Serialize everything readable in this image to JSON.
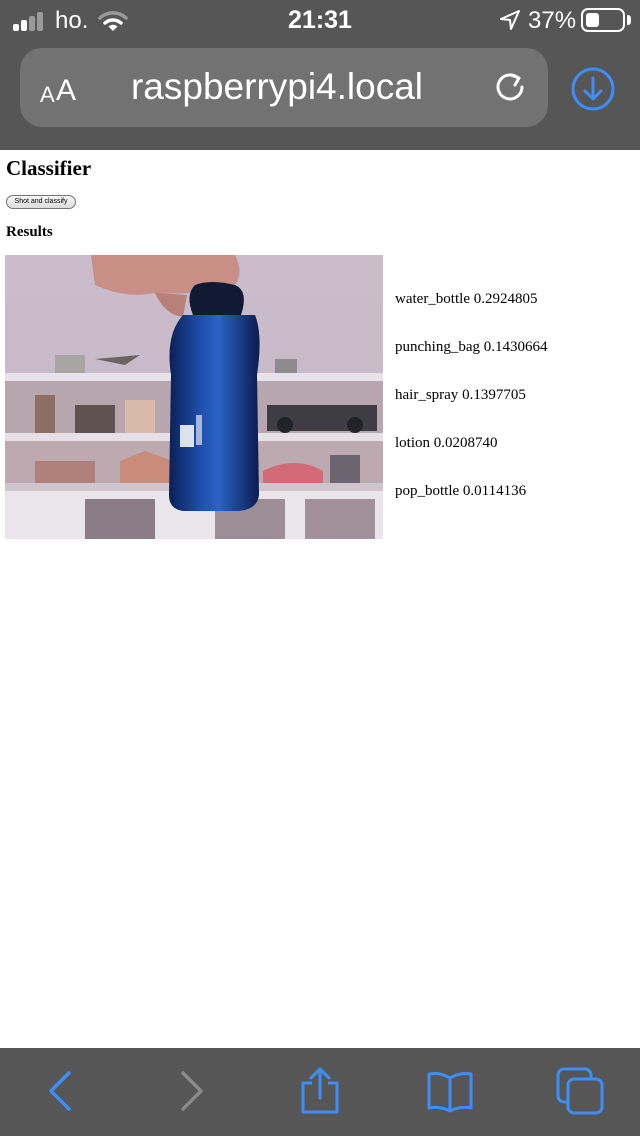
{
  "status_bar": {
    "carrier": "ho.",
    "time": "21:31",
    "battery_percent": "37%",
    "signal_bars": 2,
    "battery_level": 0.37,
    "icons": [
      "signal-icon",
      "wifi-icon",
      "location-arrow-icon",
      "battery-icon"
    ]
  },
  "url_bar": {
    "reader_small": "A",
    "reader_big": "A",
    "url": "raspberrypi4.local",
    "icons": [
      "reload-icon",
      "download-icon"
    ]
  },
  "page": {
    "title": "Classifier",
    "shot_button_label": "Shot and classify",
    "results_heading": "Results",
    "results": [
      {
        "label": "water_bottle",
        "score": "0.2924805"
      },
      {
        "label": "punching_bag",
        "score": "0.1430664"
      },
      {
        "label": "hair_spray",
        "score": "0.1397705"
      },
      {
        "label": "lotion",
        "score": "0.0208740"
      },
      {
        "label": "pop_bottle",
        "score": "0.0114136"
      }
    ]
  },
  "toolbar": {
    "icons": [
      "back-icon",
      "forward-icon",
      "share-icon",
      "bookmarks-icon",
      "tabs-icon"
    ]
  },
  "colors": {
    "chrome": "#565656",
    "url_field": "#727272",
    "accent": "#3e8ef7",
    "disabled": "#8a8a8a"
  }
}
